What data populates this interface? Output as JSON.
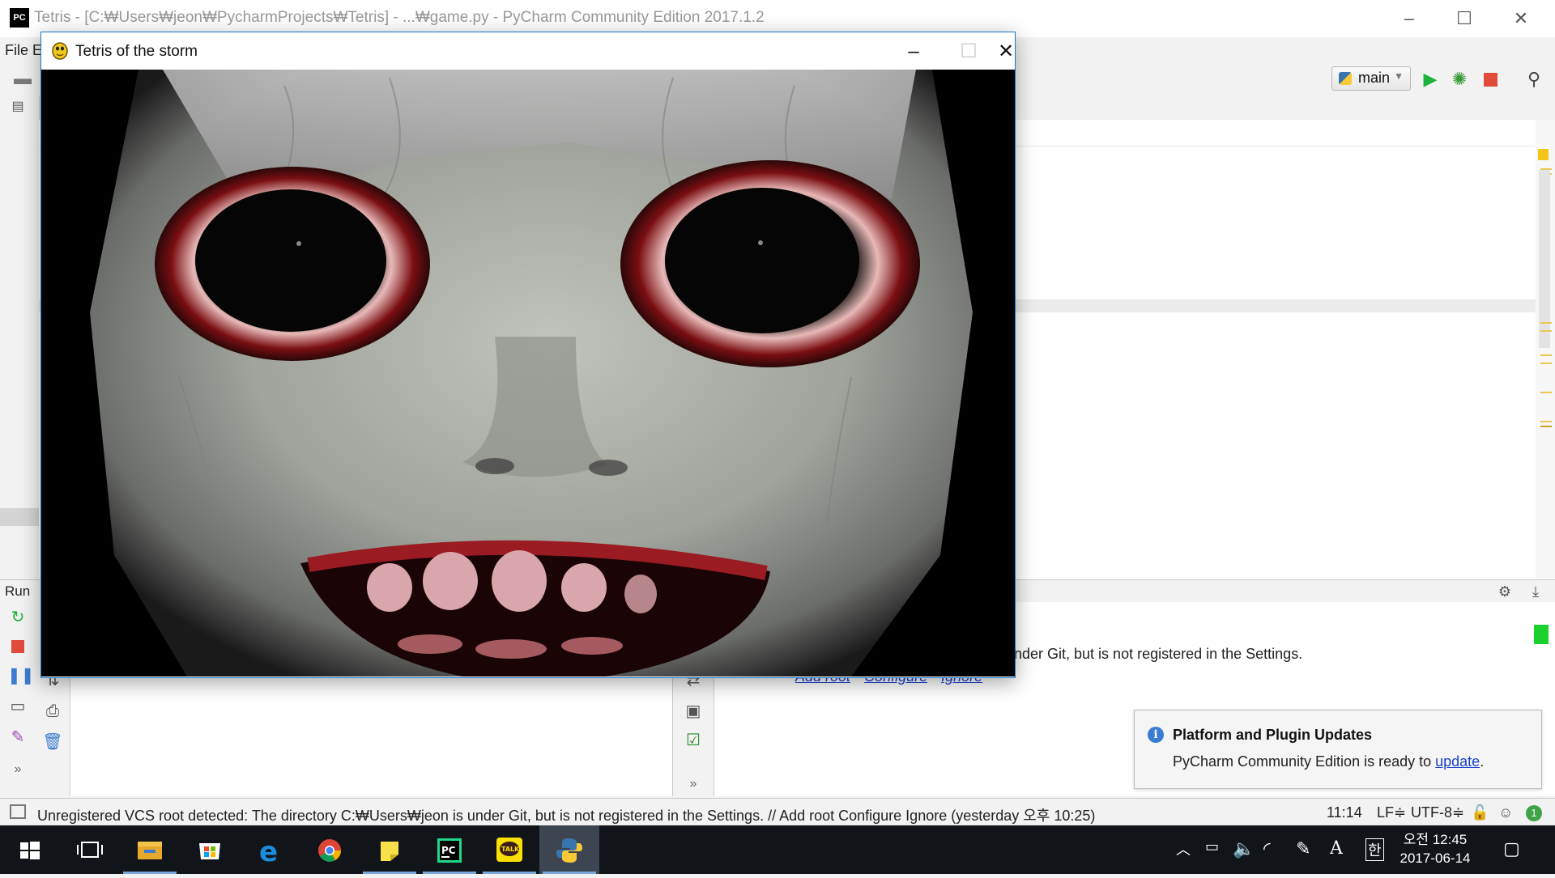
{
  "ide": {
    "title": "Tetris - [C:₩Users₩jeon₩PycharmProjects₩Tetris] - ...₩game.py - PyCharm Community Edition 2017.1.2",
    "logo": "PC",
    "menu": [
      "File",
      "E"
    ],
    "run_config": "main",
    "run_tab_label": "Run",
    "vcs_message_partial": "nder Git, but is not registered in the Settings.",
    "vcs_links": [
      "Add root",
      "Configure",
      "Ignore"
    ]
  },
  "notification": {
    "title": "Platform and Plugin Updates",
    "body_prefix": "PyCharm Community Edition is ready to ",
    "link": "update",
    "body_suffix": "."
  },
  "statusbar": {
    "message": "Unregistered VCS root detected: The directory C:₩Users₩jeon is under Git, but is not registered in the Settings. // Add root  Configure  Ignore (yesterday 오후 10:25)",
    "position": "11:14",
    "line_sep": "LF≑",
    "encoding": "UTF-8≑",
    "event_count": "1"
  },
  "game_window": {
    "title": "Tetris of the storm"
  },
  "taskbar": {
    "apps": [
      "windows-start",
      "task-view",
      "file-explorer",
      "store",
      "edge",
      "chrome",
      "sticky-notes",
      "pycharm",
      "kakaotalk",
      "python"
    ],
    "ime_lang": "A",
    "ime_korean": "한",
    "time": "오전 12:45",
    "date": "2017-06-14"
  },
  "colors": {
    "accent_blue": "#1a73c8",
    "run_green": "#1bb33a",
    "stop_red": "#e04b3c",
    "link_blue": "#1a3fd0"
  }
}
